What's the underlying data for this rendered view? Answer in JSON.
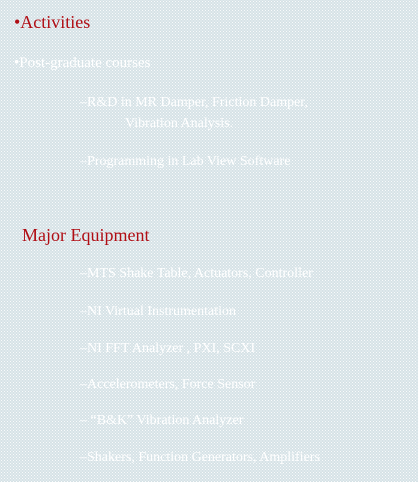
{
  "section1": {
    "heading": "•Activities",
    "subheading": "•Post-graduate courses",
    "items": [
      {
        "line1": "–R&D in MR Damper, Friction Damper,",
        "line2": "Vibration Analysis."
      },
      {
        "line1": "–Programming in Lab View Software"
      }
    ]
  },
  "section2": {
    "heading": "Major Equipment",
    "items": [
      "–MTS Shake Table, Actuators, Controller",
      "–NI Virtual Instrumentation",
      "–NI FFT Analyzer , PXI, SCXI",
      "–Accelerometers, Force Sensor",
      "– “B&K” Vibration Analyzer",
      "–Shakers, Function Generators, Amplifiers"
    ]
  },
  "colors": {
    "heading": "#b00d14",
    "body_text": "#ffffff",
    "background": "#cfdde2"
  }
}
